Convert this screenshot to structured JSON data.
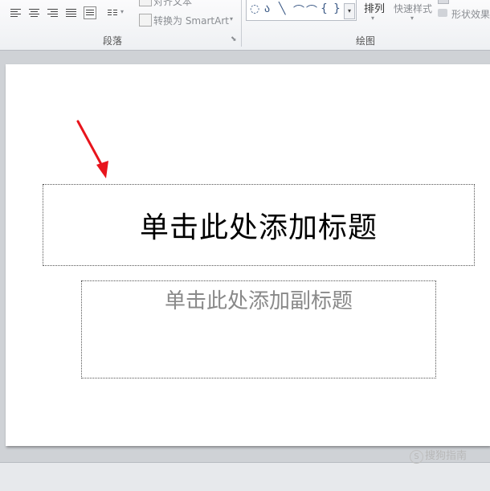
{
  "ribbon": {
    "paragraph_group_label": "段落",
    "drawing_group_label": "绘图",
    "align_text_label": "对齐文本",
    "convert_smartart_label": "转换为 SmartArt",
    "arrange_label": "排列",
    "quick_styles_label": "快速样式",
    "shape_effects_label": "形状效果",
    "shape_glyphs": [
      "◌",
      "ა",
      "╲",
      "⌒",
      "⌒",
      "{",
      "}"
    ]
  },
  "slide": {
    "title_placeholder": "单击此处添加标题",
    "subtitle_placeholder": "单击此处添加副标题"
  },
  "watermark": {
    "logo": "S",
    "text": "搜狗指南"
  },
  "colors": {
    "arrow": "#e8141c",
    "workspace": "#cfd2d6"
  }
}
